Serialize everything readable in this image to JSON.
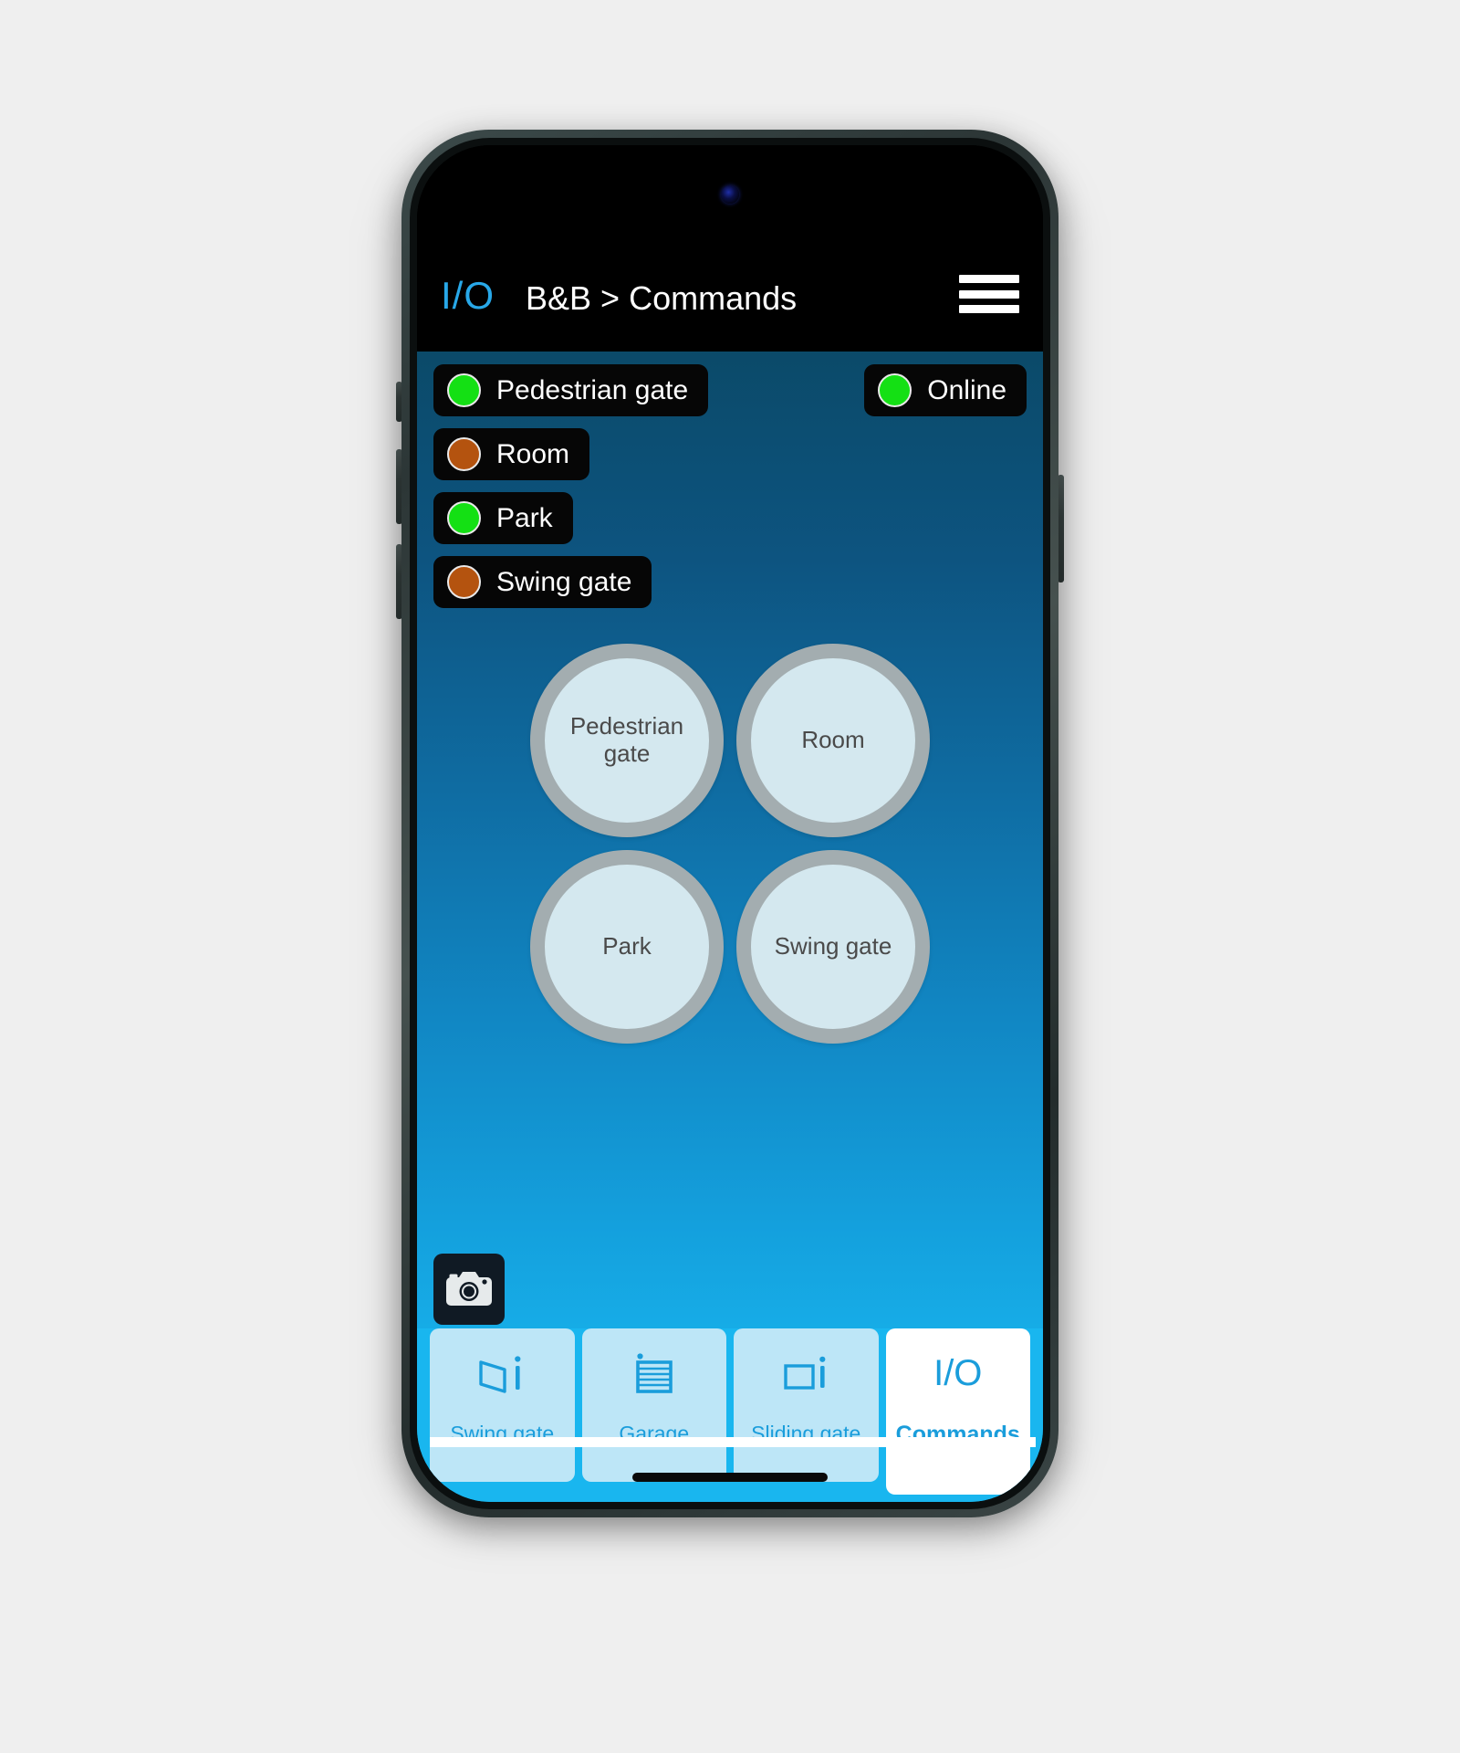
{
  "app": {
    "brand_logo": "I/O",
    "breadcrumb": "B&B > Commands",
    "menu_icon": "hamburger-menu-icon"
  },
  "status": {
    "devices": [
      {
        "label": "Pedestrian gate",
        "state_color": "#14e014",
        "state": "green"
      },
      {
        "label": "Room",
        "state_color": "#b4530f",
        "state": "orange"
      },
      {
        "label": "Park",
        "state_color": "#14e014",
        "state": "green"
      },
      {
        "label": "Swing gate",
        "state_color": "#b4530f",
        "state": "orange"
      }
    ],
    "connection": {
      "label": "Online",
      "state_color": "#14e014"
    }
  },
  "commands": [
    {
      "label": "Pedestrian gate"
    },
    {
      "label": "Room"
    },
    {
      "label": "Park"
    },
    {
      "label": "Swing gate"
    }
  ],
  "camera": {
    "icon": "camera-icon"
  },
  "tabbar": {
    "tabs": [
      {
        "label": "Swing gate",
        "icon": "swing-gate-icon",
        "active": false
      },
      {
        "label": "Garage",
        "icon": "garage-door-icon",
        "active": false
      },
      {
        "label": "Sliding gate",
        "icon": "sliding-gate-icon",
        "active": false
      },
      {
        "label": "Commands",
        "icon": "io-logo-icon",
        "active": true,
        "icon_text": "I/O"
      }
    ]
  },
  "colors": {
    "accent_blue": "#19b6ef",
    "logo_blue": "#28a8e8",
    "tab_blue": "#1a9ddb",
    "tab_inactive_bg": "#bde6f7",
    "circle_fill": "#d4e8ef",
    "circle_border": "#a3adb0",
    "pill_bg": "#060606",
    "header_bg": "#000000"
  }
}
